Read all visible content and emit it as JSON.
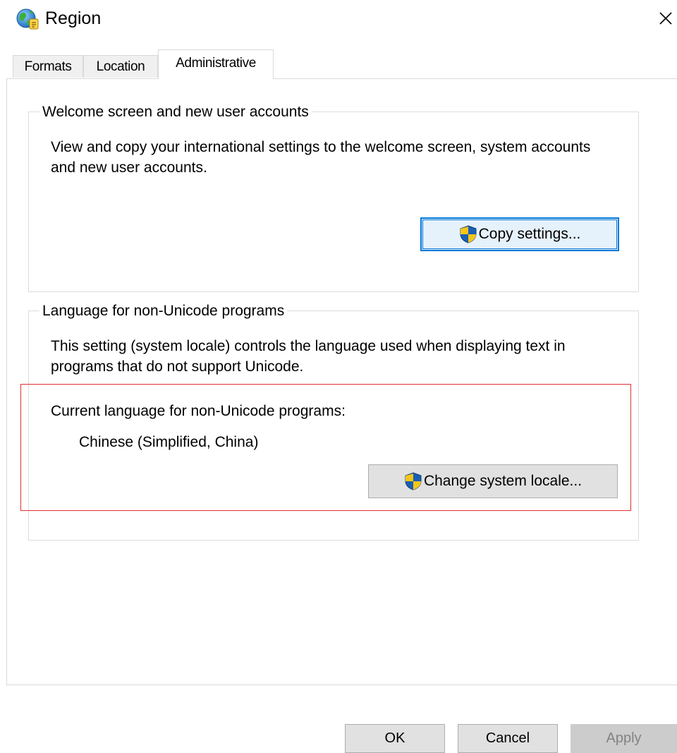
{
  "window": {
    "title": "Region",
    "close_glyph": "✕",
    "icon": "globe-icon"
  },
  "tabs": [
    {
      "label": "Formats",
      "selected": false
    },
    {
      "label": "Location",
      "selected": false
    },
    {
      "label": "Administrative",
      "selected": true
    }
  ],
  "welcome_group": {
    "title": "Welcome screen and new user accounts",
    "description": "View and copy your international settings to the welcome screen, system accounts and new user accounts.",
    "button_label": "Copy settings...",
    "button_icon": "uac-shield-icon"
  },
  "language_group": {
    "title": "Language for non-Unicode programs",
    "description": "This setting (system locale) controls the language used when displaying text in programs that do not support Unicode.",
    "current_label": "Current language for non-Unicode programs:",
    "current_value": "Chinese (Simplified, China)",
    "button_label": "Change system locale...",
    "button_icon": "uac-shield-icon"
  },
  "footer": {
    "ok_label": "OK",
    "cancel_label": "Cancel",
    "apply_label": "Apply",
    "apply_enabled": false
  },
  "colors": {
    "focus_border": "#0078d7",
    "highlight_border": "#e03030",
    "button_face": "#e1e1e1",
    "disabled_text": "#838383"
  }
}
